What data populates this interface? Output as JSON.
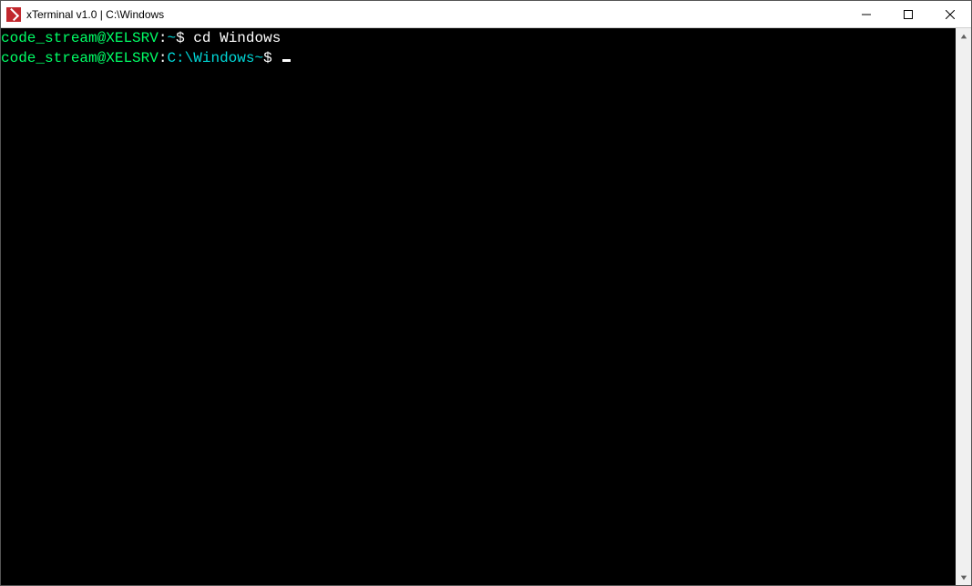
{
  "window": {
    "title": "xTerminal v1.0 | C:\\Windows"
  },
  "terminal": {
    "lines": [
      {
        "user": "code_stream",
        "sep_at": "@",
        "host": "XELSRV",
        "colon": ":",
        "path": "~",
        "prompt": "$",
        "command": "cd Windows"
      },
      {
        "user": "code_stream",
        "sep_at": "@",
        "host": "XELSRV",
        "colon": ":",
        "path": "C:\\Windows~",
        "prompt": "$",
        "command": ""
      }
    ]
  }
}
